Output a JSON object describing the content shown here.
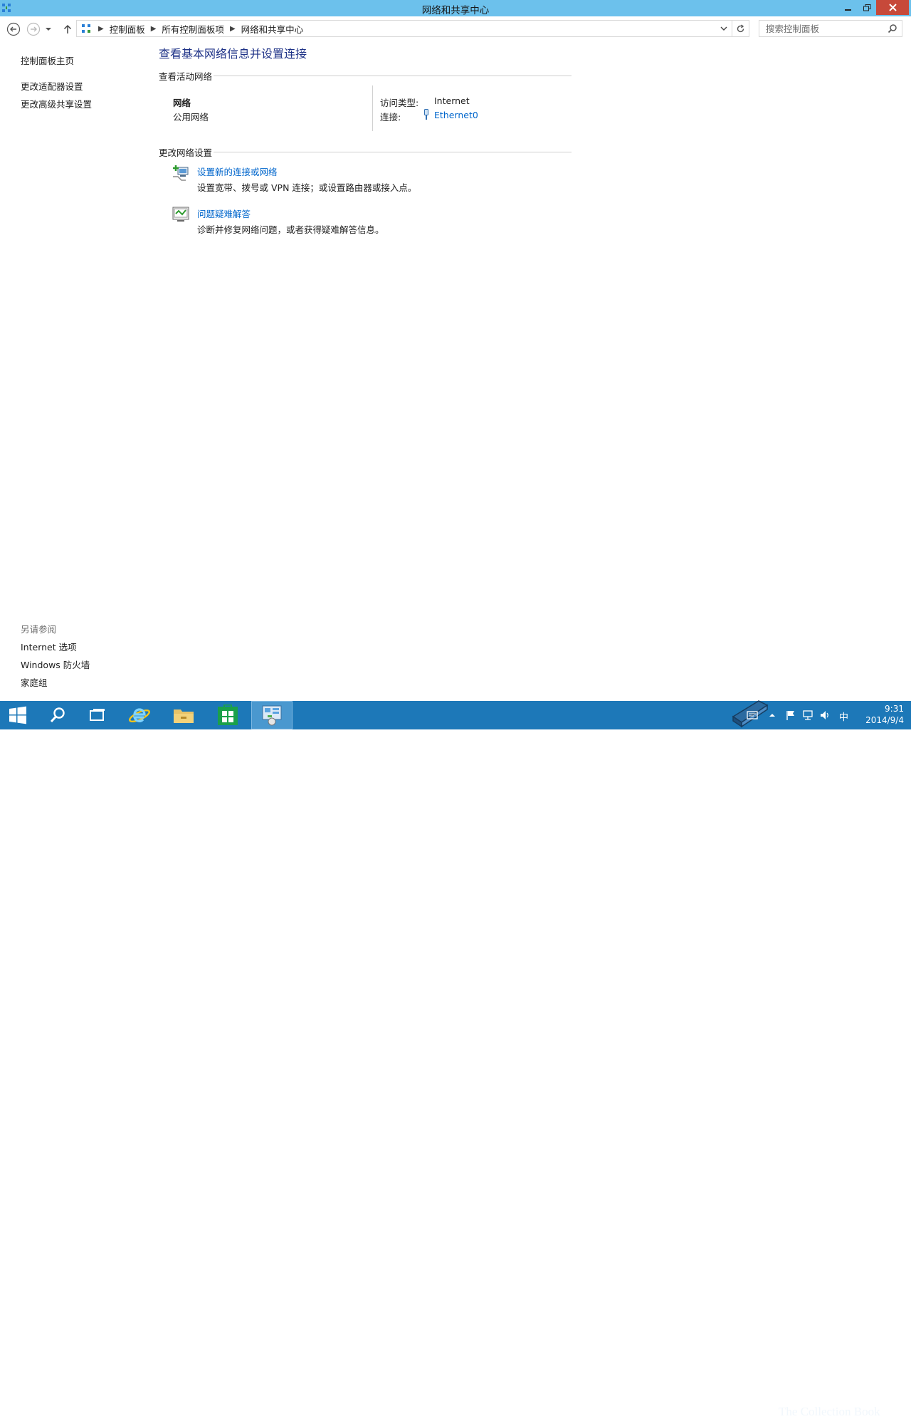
{
  "window": {
    "title": "网络和共享中心"
  },
  "address": {
    "crumbs": [
      "控制面板",
      "所有控制面板项",
      "网络和共享中心"
    ],
    "search_placeholder": "搜索控制面板"
  },
  "left_pane": {
    "home_link": "控制面板主页",
    "links": [
      "更改适配器设置",
      "更改高级共享设置"
    ],
    "see_also_heading": "另请参阅",
    "see_also": [
      "Internet 选项",
      "Windows 防火墙",
      "家庭组"
    ]
  },
  "main": {
    "title": "查看基本网络信息并设置连接",
    "active_networks_heading": "查看活动网络",
    "network": {
      "name": "网络",
      "type": "公用网络",
      "access_label": "访问类型:",
      "access_value": "Internet",
      "connection_label": "连接:",
      "connection_value": "Ethernet0"
    },
    "change_settings_heading": "更改网络设置",
    "tasks": [
      {
        "link": "设置新的连接或网络",
        "desc": "设置宽带、拨号或 VPN 连接；或设置路由器或接入点。",
        "icon": "new-connection-icon"
      },
      {
        "link": "问题疑难解答",
        "desc": "诊断并修复网络问题，或者获得疑难解答信息。",
        "icon": "troubleshoot-icon"
      }
    ]
  },
  "taskbar": {
    "time": "9:31",
    "date": "2014/9/4",
    "ime": "中",
    "watermark": "The Collection Book"
  },
  "colors": {
    "titlebar": "#6cc1ec",
    "close_button": "#c7493a",
    "taskbar": "#1d78b8",
    "link": "#0066cc",
    "main_title": "#1e3287"
  }
}
